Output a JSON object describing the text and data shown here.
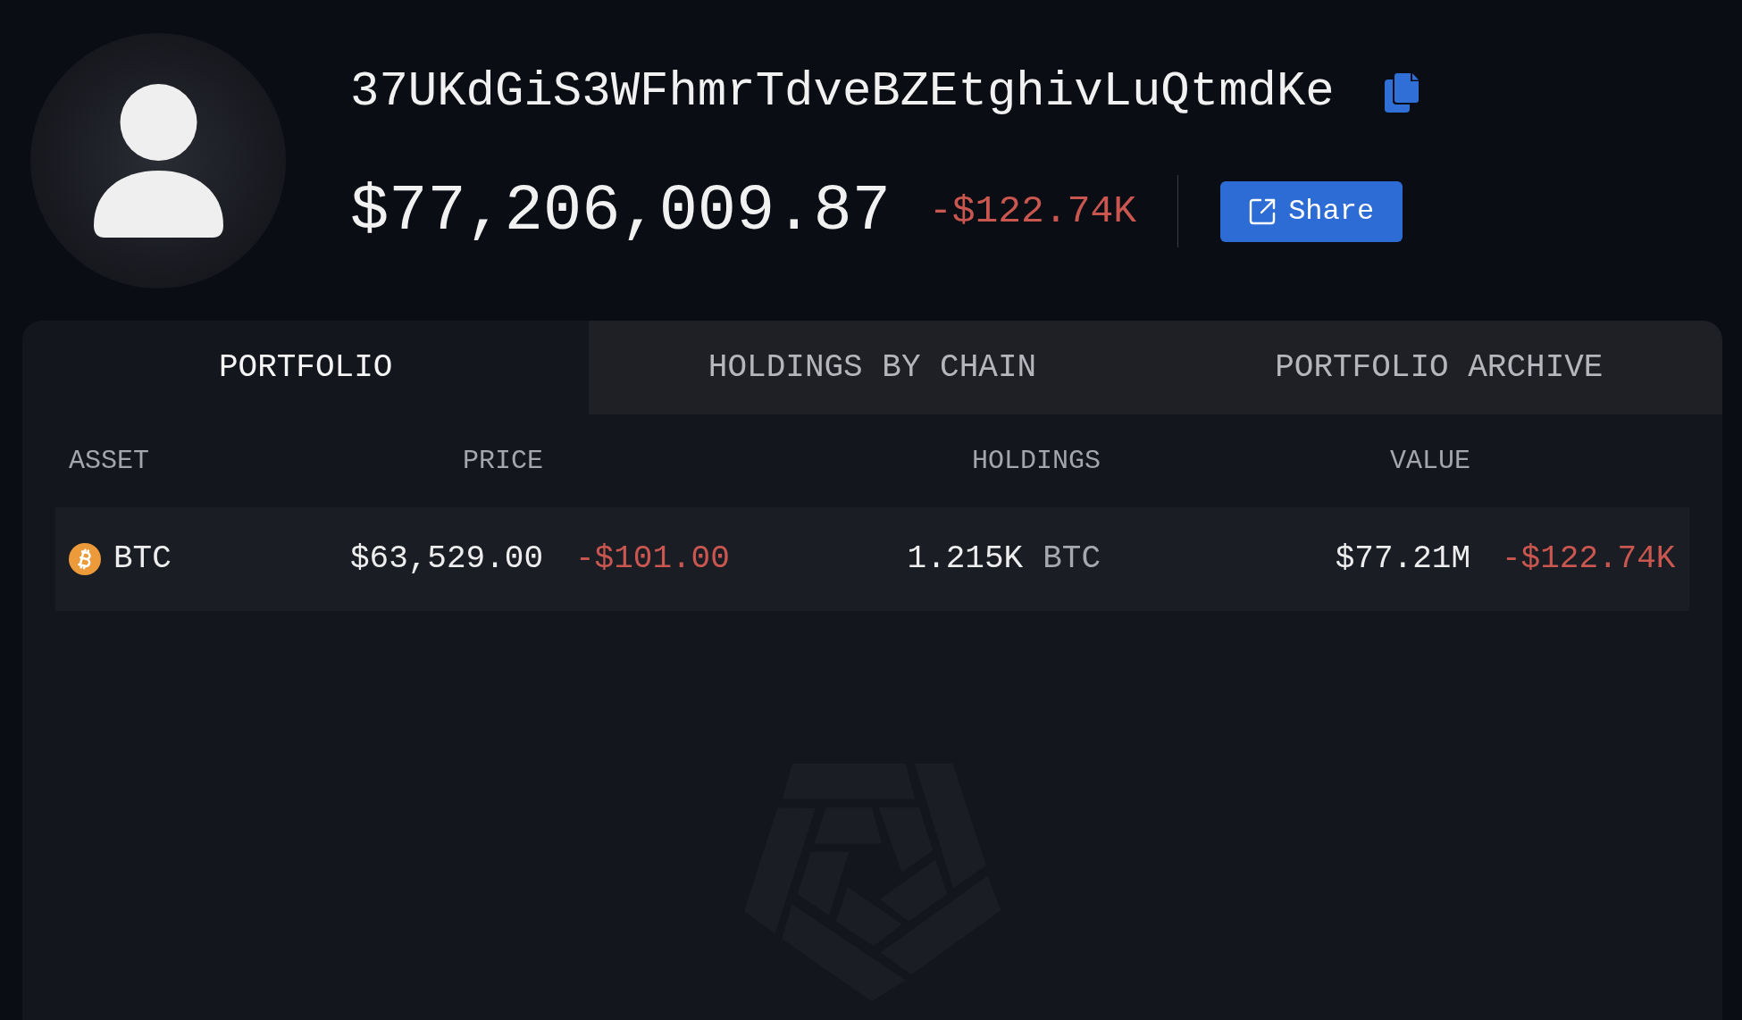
{
  "profile": {
    "address": "37UKdGiS3WFhmrTdveBZEtghivLuQtmdKe",
    "balance": "$77,206,009.87",
    "change": "-$122.74K",
    "share_button": "Share"
  },
  "tabs": [
    {
      "label": "PORTFOLIO",
      "selected": true
    },
    {
      "label": "HOLDINGS BY CHAIN",
      "selected": false
    },
    {
      "label": "PORTFOLIO ARCHIVE",
      "selected": false
    }
  ],
  "table": {
    "columns": [
      "ASSET",
      "PRICE",
      "HOLDINGS",
      "VALUE"
    ],
    "rows": [
      {
        "asset": "BTC",
        "price": "$63,529.00",
        "price_change": "-$101.00",
        "holdings": "1.215K",
        "holdings_unit": "BTC",
        "value": "$77.21M",
        "value_change": "-$122.74K"
      }
    ]
  }
}
